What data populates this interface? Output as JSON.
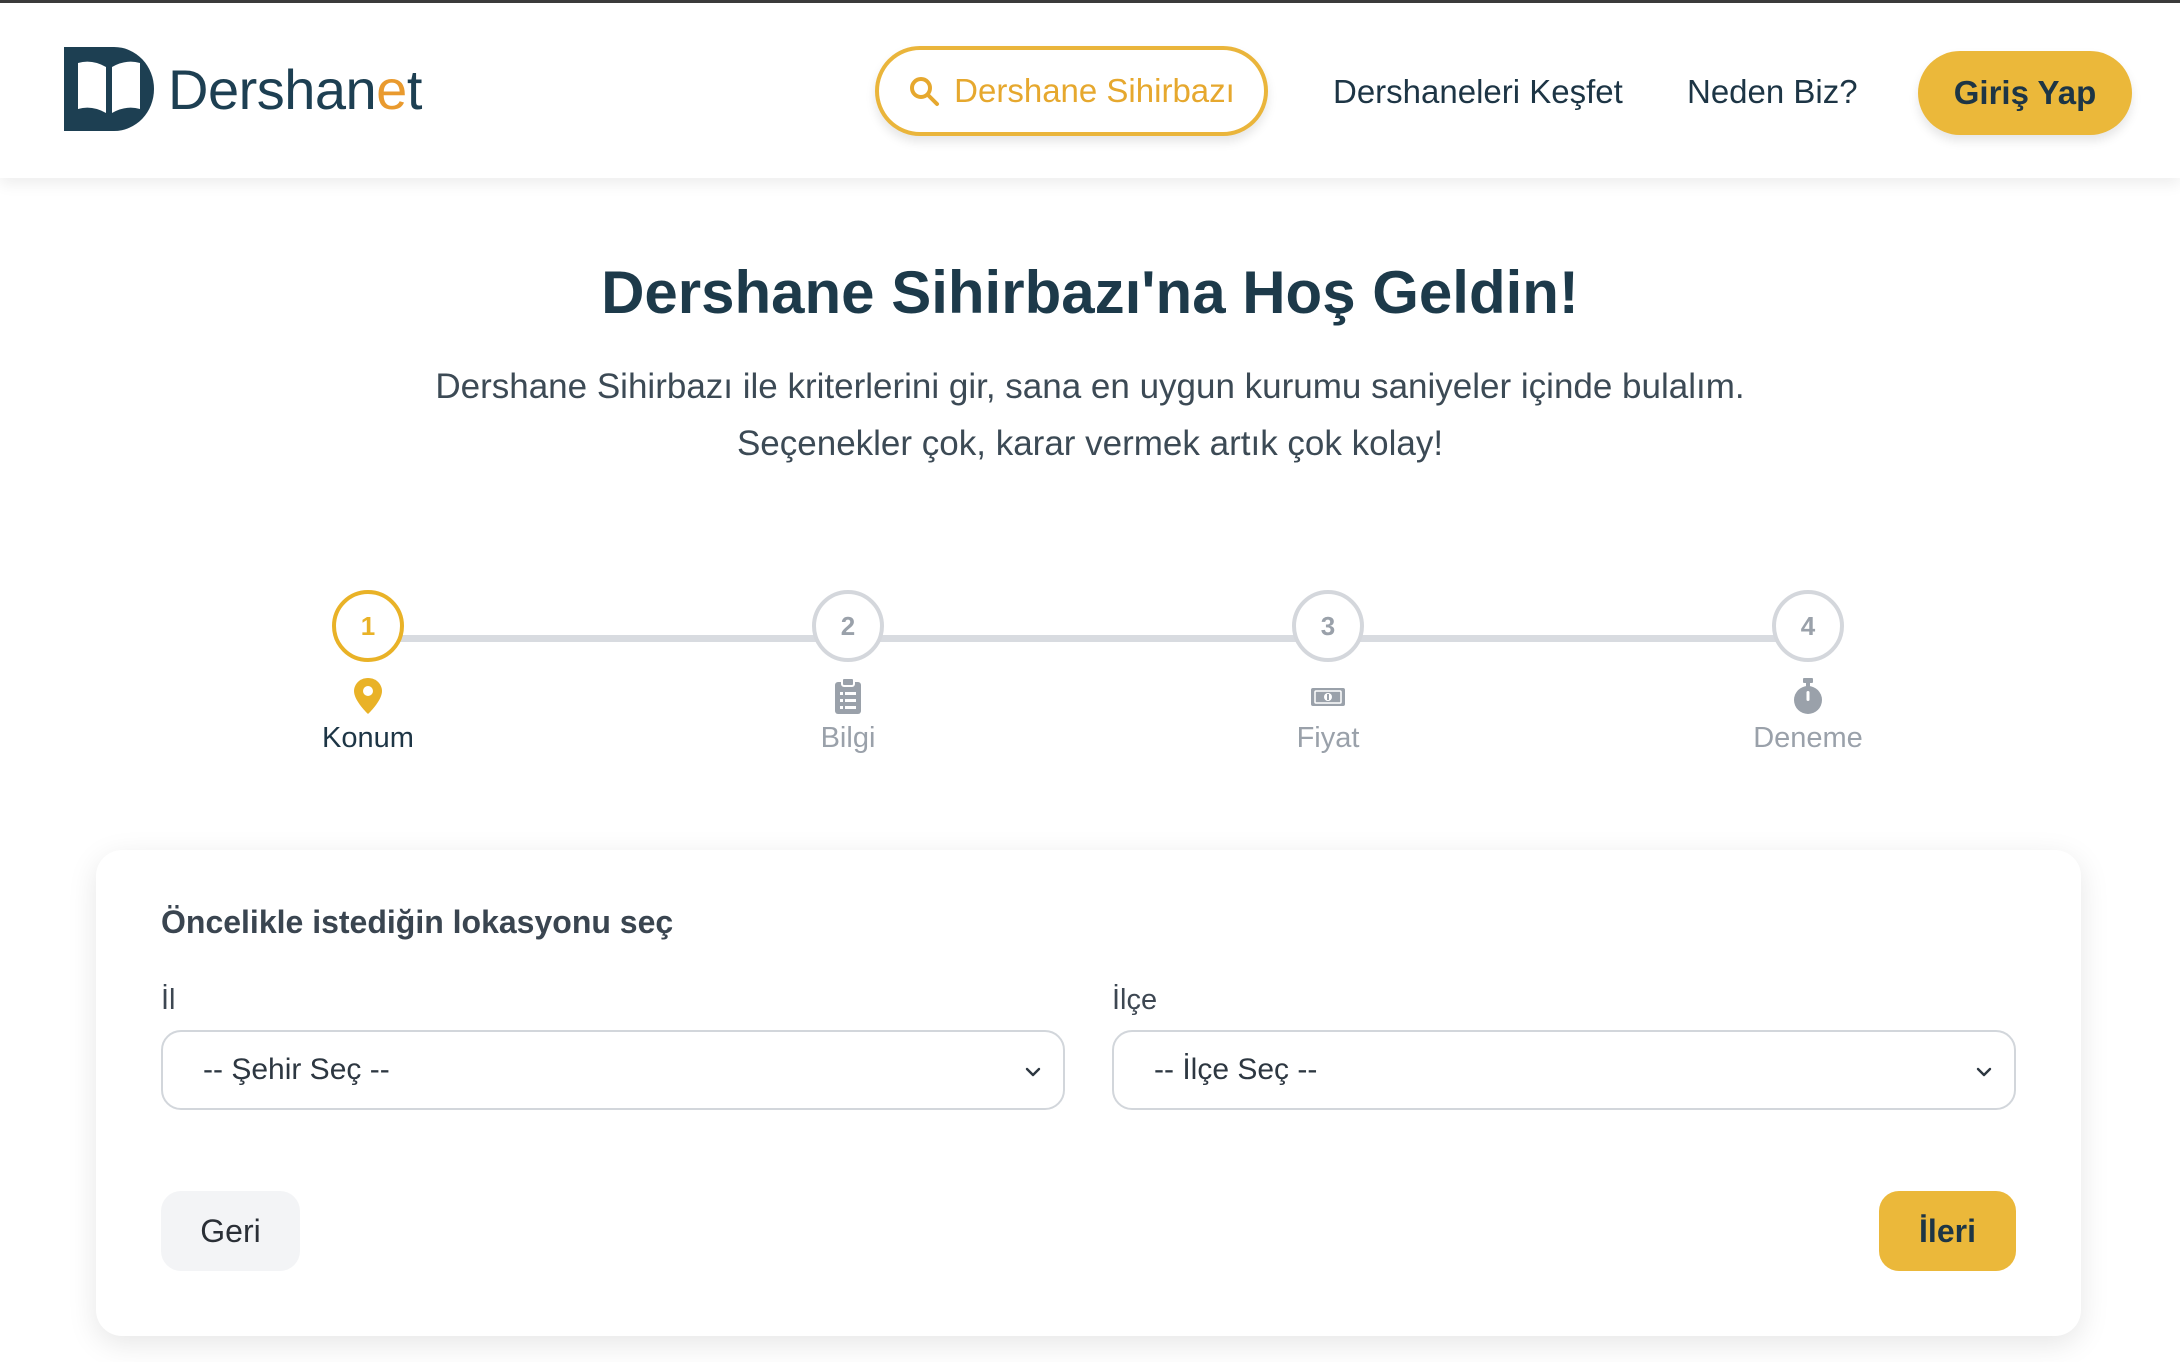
{
  "header": {
    "logo": {
      "text_main": "Dershan",
      "text_accent": "e",
      "text_tail": "t"
    },
    "nav": {
      "wizard_label": "Dershane Sihirbazı",
      "explore_label": "Dershaneleri Keşfet",
      "why_label": "Neden Biz?",
      "login_label": "Giriş Yap"
    }
  },
  "hero": {
    "title": "Dershane Sihirbazı'na Hoş Geldin!",
    "subtitle_line1": "Dershane Sihirbazı ile kriterlerini gir, sana en uygun kurumu saniyeler içinde bulalım.",
    "subtitle_line2": "Seçenekler çok, karar vermek artık çok kolay!"
  },
  "stepper": {
    "steps": [
      {
        "number": "1",
        "label": "Konum",
        "icon": "map-pin-icon",
        "active": true
      },
      {
        "number": "2",
        "label": "Bilgi",
        "icon": "clipboard-list-icon",
        "active": false
      },
      {
        "number": "3",
        "label": "Fiyat",
        "icon": "banknote-icon",
        "active": false
      },
      {
        "number": "4",
        "label": "Deneme",
        "icon": "stopwatch-icon",
        "active": false
      }
    ]
  },
  "form": {
    "title": "Öncelikle istediğin lokasyonu seç",
    "city": {
      "label": "İl",
      "value": "-- Şehir Seç --"
    },
    "district": {
      "label": "İlçe",
      "value": "-- İlçe Seç --"
    },
    "back_label": "Geri",
    "next_label": "İleri"
  },
  "colors": {
    "accent": "#ebb83a",
    "primary_text": "#1d3a4a",
    "inactive": "#9aa1aa"
  }
}
